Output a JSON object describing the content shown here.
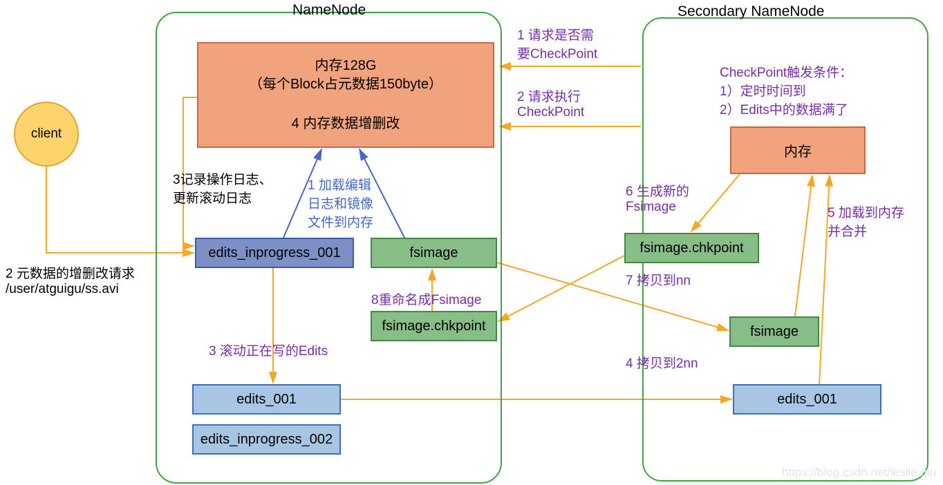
{
  "titles": {
    "nn": "NameNode",
    "snn": "Secondary NameNode"
  },
  "client": "client",
  "mem_nn": {
    "l1": "内存128G",
    "l2": "（每个Block占元数据150byte）",
    "l3": "4 内存数据增删改"
  },
  "mem_snn": "内存",
  "boxes": {
    "edits_inprog1": "edits_inprogress_001",
    "fsimage_nn": "fsimage",
    "fsimage_chk_nn": "fsimage.chkpoint",
    "fsimage_chk_snn": "fsimage.chkpoint",
    "fsimage_snn": "fsimage",
    "edits001_nn": "edits_001",
    "edits_inprog2": "edits_inprogress_002",
    "edits001_snn": "edits_001"
  },
  "labels": {
    "req2": "2 元数据的增删改请求\n/user/atguigu/ss.avi",
    "log3": "3记录操作日志、\n更新滚动日志",
    "load1": "1 加载编辑\n日志和镜像\n文件到内存",
    "roll3": "3 滚动正在写的Edits",
    "rename8": "8重命名成Fsimage",
    "copy4": "4 拷贝到2nn",
    "copy7": "7 拷贝到nn",
    "gen6": "6 生成新的\nFsimage",
    "load5": "5 加载到内存\n并合并",
    "ask1": "1 请求是否需\n要CheckPoint",
    "ask2": "2 请求执行\nCheckPoint",
    "cond": "CheckPoint触发条件：\n1）定时时间到\n2）Edits中的数据满了"
  },
  "watermark": "https://blog.csdn.net/leslie.qin"
}
